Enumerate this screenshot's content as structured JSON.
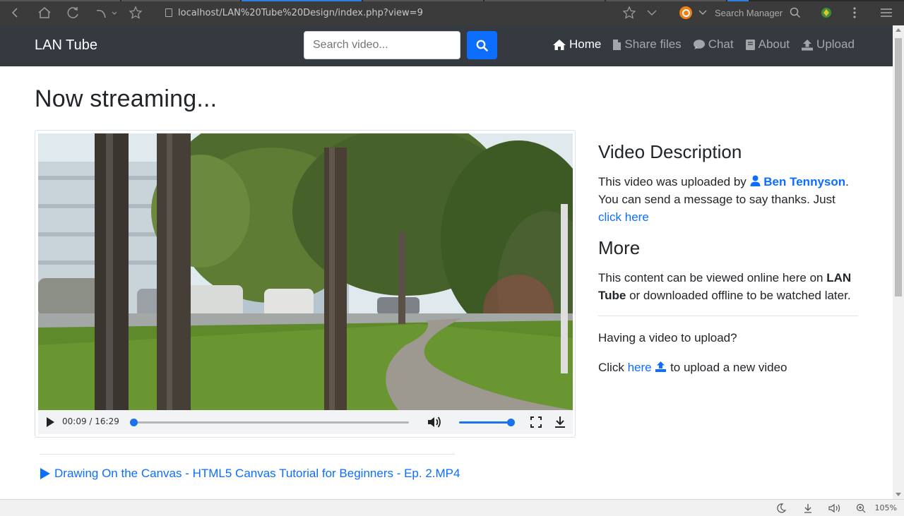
{
  "browser": {
    "url": "localhost/LAN%20Tube%20Design/index.php?view=9",
    "search_manager_label": "Search Manager",
    "zoom": "105%"
  },
  "navbar": {
    "brand": "LAN Tube",
    "search_placeholder": "Search video...",
    "links": [
      {
        "label": "Home",
        "icon": "home-icon",
        "active": true
      },
      {
        "label": "Share files",
        "icon": "file-icon",
        "active": false
      },
      {
        "label": "Chat",
        "icon": "chat-icon",
        "active": false
      },
      {
        "label": "About",
        "icon": "book-icon",
        "active": false
      },
      {
        "label": "Upload",
        "icon": "upload-icon",
        "active": false
      }
    ]
  },
  "main": {
    "title": "Now streaming...",
    "player": {
      "current_time": "00:09",
      "duration": "16:29",
      "time_display": "00:09 / 16:29",
      "progress": 0.01,
      "volume": 1.0
    },
    "related": {
      "title": "Drawing On the Canvas - HTML5 Canvas Tutorial for Beginners - Ep. 2.MP4"
    }
  },
  "sidebar": {
    "description_heading": "Video Description",
    "uploaded_by_prefix": "This video was uploaded by",
    "uploader": "Ben Tennyson",
    "message_text": "You can send a message to say thanks. Just",
    "click_here": "click here",
    "more_heading": "More",
    "more_text_1": "This content can be viewed online here on",
    "more_brand": "LAN Tube",
    "more_text_2": "or downloaded offline to be watched later.",
    "upload_question": "Having a video to upload?",
    "upload_click": "Click",
    "upload_here": "here",
    "upload_suffix": "to upload a new video"
  },
  "colors": {
    "navbar_bg": "#343a40",
    "primary": "#0d6efd"
  }
}
